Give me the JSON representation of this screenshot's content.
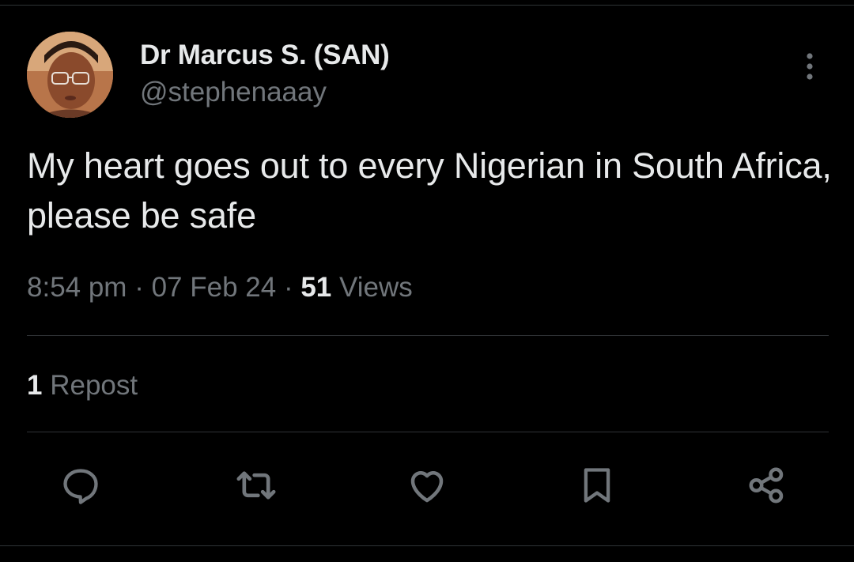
{
  "tweet": {
    "author": {
      "display_name": "Dr Marcus S. (SAN)",
      "handle": "@stephenaaay"
    },
    "text": "My heart goes out to every Nigerian in South Africa, please be safe",
    "time": "8:54 pm",
    "separator": "·",
    "date": "07 Feb 24",
    "views_count": "51",
    "views_label": "Views",
    "repost_count": "1",
    "repost_label": "Repost"
  },
  "actions": [
    {
      "name": "reply",
      "icon": "reply-icon"
    },
    {
      "name": "retweet",
      "icon": "retweet-icon"
    },
    {
      "name": "like",
      "icon": "heart-icon"
    },
    {
      "name": "bookmark",
      "icon": "bookmark-icon"
    },
    {
      "name": "share",
      "icon": "share-icon"
    }
  ],
  "colors": {
    "background": "#000000",
    "primary_text": "#e7e9ea",
    "secondary_text": "#71767b",
    "divider": "#2f3336"
  }
}
